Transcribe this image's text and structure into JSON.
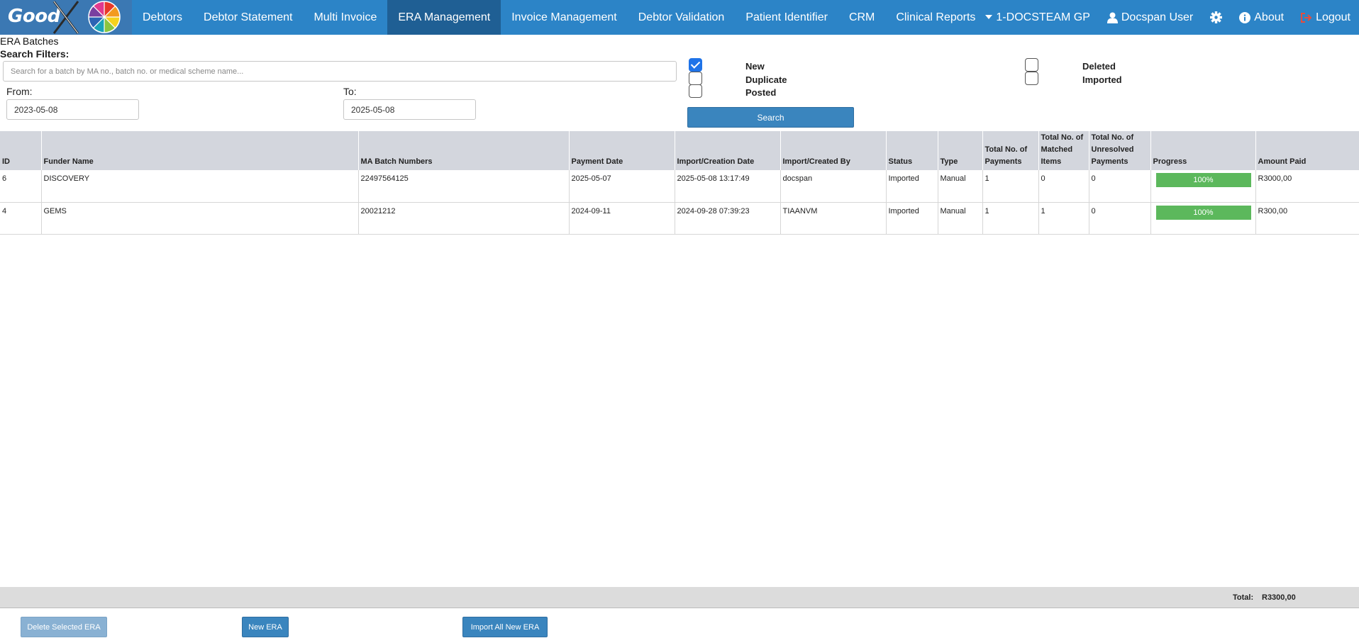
{
  "app": {
    "logo_text": "Good"
  },
  "nav": {
    "items": [
      {
        "label": "Debtors"
      },
      {
        "label": "Debtor Statement"
      },
      {
        "label": "Multi Invoice"
      },
      {
        "label": "ERA Management",
        "active": true
      },
      {
        "label": "Invoice Management"
      },
      {
        "label": "Debtor Validation"
      },
      {
        "label": "Patient Identifier"
      },
      {
        "label": "CRM"
      },
      {
        "label": "Clinical Reports"
      }
    ],
    "practice": "1-DOCSTEAM GP",
    "user": "Docspan User",
    "about": "About",
    "logout": "Logout"
  },
  "page": {
    "title": "ERA Batches"
  },
  "filters": {
    "label": "Search Filters:",
    "search_placeholder": "Search for a batch by MA no., batch no. or medical scheme name...",
    "from_label": "From:",
    "from_value": "2023-05-08",
    "to_label": "To:",
    "to_value": "2025-05-08",
    "statuses": [
      {
        "label": "New",
        "checked": true
      },
      {
        "label": "Duplicate",
        "checked": false
      },
      {
        "label": "Posted",
        "checked": false
      },
      {
        "label": "Deleted",
        "checked": false
      },
      {
        "label": "Imported",
        "checked": false
      }
    ],
    "search_button": "Search"
  },
  "table": {
    "columns": [
      "ID",
      "Funder Name",
      "MA Batch Numbers",
      "Payment Date",
      "Import/Creation Date",
      "Import/Created By",
      "Status",
      "Type",
      "Total No. of Payments",
      "Total No. of Matched Items",
      "Total No. of Unresolved Payments",
      "Progress",
      "Amount Paid"
    ],
    "rows": [
      {
        "id": "6",
        "funder": "DISCOVERY",
        "batch": "22497564125",
        "payment_date": "2025-05-07",
        "import_date": "2025-05-08 13:17:49",
        "created_by": "docspan",
        "status": "Imported",
        "type": "Manual",
        "payments": "1",
        "matched": "0",
        "unresolved": "0",
        "progress": "100%",
        "amount": "R3000,00"
      },
      {
        "id": "4",
        "funder": "GEMS",
        "batch": "20021212",
        "payment_date": "2024-09-11",
        "import_date": "2024-09-28 07:39:23",
        "created_by": "TIAANVM",
        "status": "Imported",
        "type": "Manual",
        "payments": "1",
        "matched": "1",
        "unresolved": "0",
        "progress": "100%",
        "amount": "R300,00"
      }
    ]
  },
  "footer": {
    "total_label": "Total:",
    "total_value": "R3300,00",
    "delete_button": "Delete Selected ERA",
    "new_button": "New ERA",
    "import_button": "Import All New ERA"
  },
  "colors": {
    "nav_bg": "#2c84c7",
    "nav_active": "#1f5f94",
    "button": "#3a85be",
    "progress": "#5cb85c",
    "header_bg": "#d3d6dd"
  }
}
